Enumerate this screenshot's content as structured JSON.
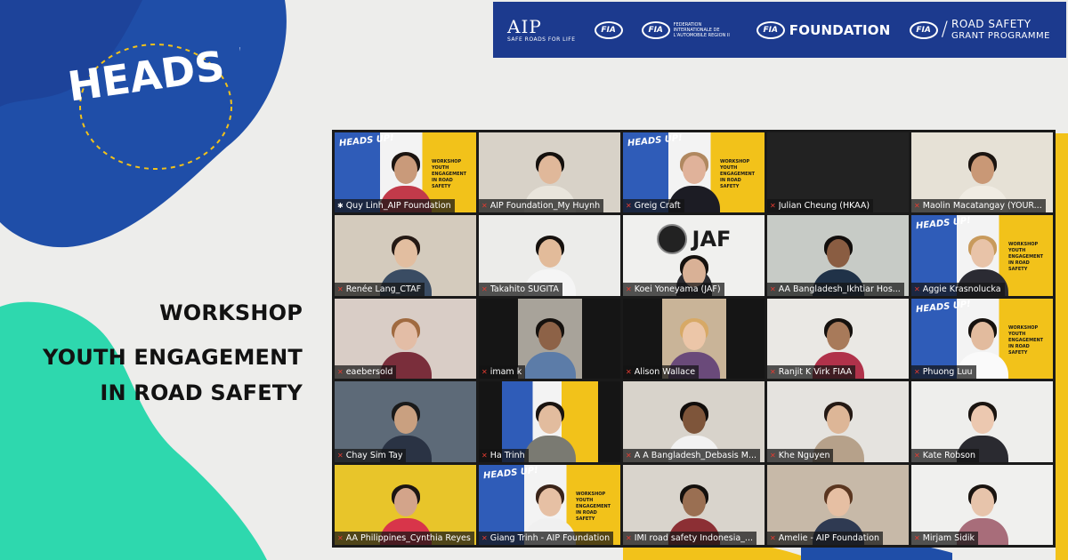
{
  "branding": {
    "logo_text": "HEADS UP!",
    "colors": {
      "navy": "#1c3a8e",
      "blue": "#1f5fb8",
      "teal": "#2ed8ae",
      "yellow": "#f2c21a"
    }
  },
  "workshop": {
    "label": "WORKSHOP",
    "title_line1": "YOUTH ENGAGEMENT",
    "title_line2": "IN ROAD SAFETY"
  },
  "sponsors": {
    "aip_big": "AIP",
    "aip_tag": "SAFE ROADS FOR LIFE",
    "fia": "FIA",
    "fia_region_text": "FEDERATION INTERNATIONALE DE L'AUTOMOBILE REGION II",
    "foundation": "FOUNDATION",
    "grant_line1": "ROAD SAFETY",
    "grant_line2": "GRANT PROGRAMME"
  },
  "slide": {
    "logo": "HEADS UP!",
    "text": "WORKSHOP YOUTH ENGAGEMENT IN ROAD SAFETY"
  },
  "jaf_logo": "JAF",
  "participants": [
    {
      "name": "Quy Linh_AIP Foundation",
      "active": true,
      "bg": "slide",
      "skin": "#c99a7a",
      "hair": "#1b1410",
      "body": "#c23a4a"
    },
    {
      "name": "AIP Foundation_My Huynh",
      "bg": "#d8d2c8",
      "skin": "#e0b89a",
      "hair": "#15110e",
      "body": "#e9e5dc"
    },
    {
      "name": "Greig Craft",
      "bg": "slide",
      "skin": "#e0b29a",
      "hair": "#b08860",
      "body": "#1c1c24"
    },
    {
      "name": "Julian Cheung (HKAA)",
      "bg": "#222222",
      "camera_off": true
    },
    {
      "name": "Maolin Macatangay (YOUR...",
      "bg": "#e6e1d6",
      "skin": "#c99876",
      "hair": "#1b1410",
      "body": "#f0ece3"
    },
    {
      "name": "Renée Lang_CTAF",
      "bg": "#d4cbbd",
      "skin": "#e2bea0",
      "hair": "#241914",
      "body": "#3a4c63"
    },
    {
      "name": "Takahito SUGITA",
      "bg": "#ececea",
      "skin": "#e2bb9a",
      "hair": "#16110e",
      "body": "#f5f5f5"
    },
    {
      "name": "Koei Yoneyama (JAF)",
      "bg": "#f0f0ee",
      "jaf": true,
      "skin": "#d9b196",
      "hair": "#15110e",
      "body": "#2a2a2f"
    },
    {
      "name": "AA Bangladesh_Ikhtiar Hos...",
      "bg": "#c7cbc6",
      "skin": "#8a5d42",
      "hair": "#120e0c",
      "body": "#203248"
    },
    {
      "name": "Aggie Krasnolucka",
      "bg": "slide",
      "skin": "#e8c3a8",
      "hair": "#c89a5c",
      "body": "#2b2b33"
    },
    {
      "name": "eaebersold",
      "bg": "#d9cdc6",
      "skin": "#e3bda6",
      "hair": "#a06a40",
      "body": "#7a2e3b"
    },
    {
      "name": "imam k",
      "bg": "#151515",
      "frame": "mid",
      "frame_bg": "#a8a39a",
      "skin": "#8d6247",
      "hair": "#15110e",
      "body": "#5c7ca8"
    },
    {
      "name": "Alison Wallace",
      "bg": "#151515",
      "frame": "mid",
      "frame_bg": "#c9b498",
      "skin": "#ecc6a8",
      "hair": "#d7a966",
      "body": "#6a4a7a"
    },
    {
      "name": "Ranjit K Virk  FIAA",
      "bg": "#eae8e4",
      "skin": "#a87a5a",
      "hair": "#15110e",
      "body": "#b0324a"
    },
    {
      "name": "Phuong Luu",
      "bg": "slide",
      "skin": "#e2bb9e",
      "hair": "#16110e",
      "body": "#fafafa"
    },
    {
      "name": "Chay Sim Tay",
      "bg": "#5d6a78",
      "skin": "#c9a080",
      "hair": "#1a1a1a",
      "body": "#2a3344"
    },
    {
      "name": "Ha Trinh",
      "bg": "#151515",
      "frame": "wide",
      "frame_bg": "slide",
      "skin": "#e2bc9e",
      "hair": "#1a1410",
      "body": "#7a7a72"
    },
    {
      "name": "A A Bangladesh_Debasis M...",
      "bg": "#d8d3cb",
      "skin": "#7e553a",
      "hair": "#110d0b",
      "body": "#f2f2f2"
    },
    {
      "name": "Khe Nguyen",
      "bg": "#e5e3df",
      "skin": "#ddb697",
      "hair": "#241914",
      "body": "#b6a18a"
    },
    {
      "name": "Kate Robson",
      "bg": "#eeeeec",
      "skin": "#ecc8b0",
      "hair": "#1a1410",
      "body": "#2a2a30"
    },
    {
      "name": "AA Philippines_Cynthia Reyes",
      "bg": "#e8c52a",
      "skin": "#d3a48a",
      "hair": "#1c1512",
      "body": "#d8354a"
    },
    {
      "name": "Giang Trinh - AIP Foundation",
      "bg": "slide",
      "skin": "#e6c0a4",
      "hair": "#3a2419",
      "body": "#f0f0f0"
    },
    {
      "name": "IMI road safety Indonesia_...",
      "bg": "#d9d4cc",
      "skin": "#9a6f52",
      "hair": "#14100d",
      "body": "#8c2f34"
    },
    {
      "name": "Amelie - AIP Foundation",
      "bg": "#c7b9a8",
      "skin": "#e6bfa3",
      "hair": "#5a3620",
      "body": "#2f3a52"
    },
    {
      "name": "Mirjam Sidik",
      "bg": "#f0f0ee",
      "skin": "#e7c4ab",
      "hair": "#1a1410",
      "body": "#a86d7a"
    }
  ]
}
